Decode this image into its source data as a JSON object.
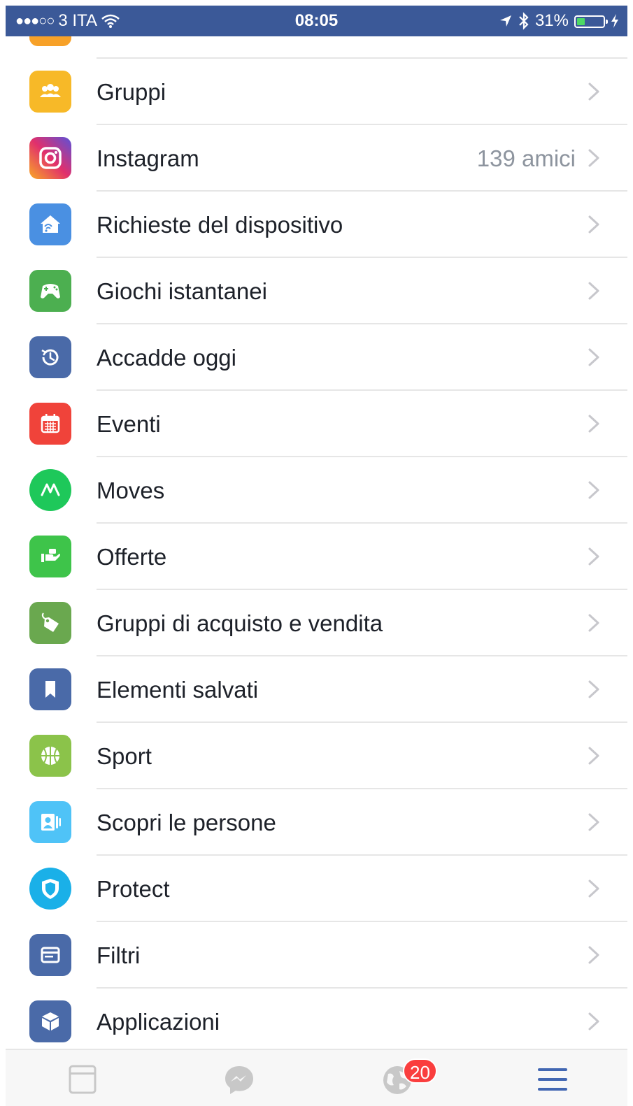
{
  "status_bar": {
    "carrier": "3 ITA",
    "time": "08:05",
    "battery": "31%",
    "battery_level": 0.31,
    "icons": [
      "signal-dots-icon",
      "wifi-icon",
      "location-arrow-icon",
      "bluetooth-icon",
      "battery-icon",
      "charging-bolt-icon"
    ]
  },
  "menu": {
    "items": [
      {
        "label": "Gruppi",
        "icon": "groups-icon",
        "color": "#f7b928"
      },
      {
        "label": "Instagram",
        "icon": "instagram-icon",
        "secondary": "139 amici",
        "color": "#c13584"
      },
      {
        "label": "Richieste del dispositivo",
        "icon": "device-home-icon",
        "color": "#4a90e2"
      },
      {
        "label": "Giochi istantanei",
        "icon": "gamepad-icon",
        "color": "#4caf50"
      },
      {
        "label": "Accadde oggi",
        "icon": "history-clock-icon",
        "color": "#4a6aa8"
      },
      {
        "label": "Eventi",
        "icon": "calendar-icon",
        "color": "#f0433a"
      },
      {
        "label": "Moves",
        "icon": "moves-icon",
        "color": "#1ec85a"
      },
      {
        "label": "Offerte",
        "icon": "offer-hand-icon",
        "color": "#3ec44a"
      },
      {
        "label": "Gruppi di acquisto e vendita",
        "icon": "price-tag-icon",
        "color": "#6aa84f"
      },
      {
        "label": "Elementi salvati",
        "icon": "bookmark-icon",
        "color": "#4a6aa8"
      },
      {
        "label": "Sport",
        "icon": "basketball-icon",
        "color": "#8bc34a"
      },
      {
        "label": "Scopri le persone",
        "icon": "people-card-icon",
        "color": "#4fc3f7"
      },
      {
        "label": "Protect",
        "icon": "shield-icon",
        "color": "#1ab0e8"
      },
      {
        "label": "Filtri",
        "icon": "filter-window-icon",
        "color": "#4a6aa8"
      },
      {
        "label": "Applicazioni",
        "icon": "cube-icon",
        "color": "#4a6aa8"
      }
    ]
  },
  "tabbar": {
    "tabs": [
      {
        "name": "news-feed-tab",
        "icon": "newsfeed-icon"
      },
      {
        "name": "messenger-tab",
        "icon": "messenger-icon"
      },
      {
        "name": "notifications-tab",
        "icon": "globe-icon",
        "badge": "20"
      },
      {
        "name": "menu-tab",
        "icon": "hamburger-menu-icon",
        "active": true
      }
    ],
    "active_color": "#4267b2",
    "inactive_color": "#c8c8c8"
  }
}
